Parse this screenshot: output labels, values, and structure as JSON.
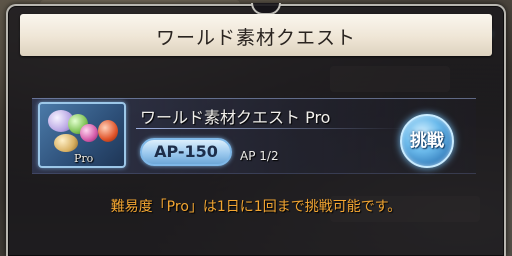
{
  "dialog": {
    "title": "ワールド素材クエスト"
  },
  "quest": {
    "name": "ワールド素材クエスト Pro",
    "thumb_label": "Pro",
    "ap_badge": "AP-150",
    "ap_cost": "AP 1/2",
    "challenge_label": "挑戦"
  },
  "notice": "難易度「Pro」は1日に1回まで挑戦可能です。",
  "colors": {
    "title_bg": "#efe6d6",
    "notice_text": "#f2a531",
    "ap_pill": "#9cc9ee",
    "challenge_button": "#6cbbec"
  },
  "icons": {
    "corner": "diamond-gem-icon",
    "thumb": "materials-icon"
  }
}
